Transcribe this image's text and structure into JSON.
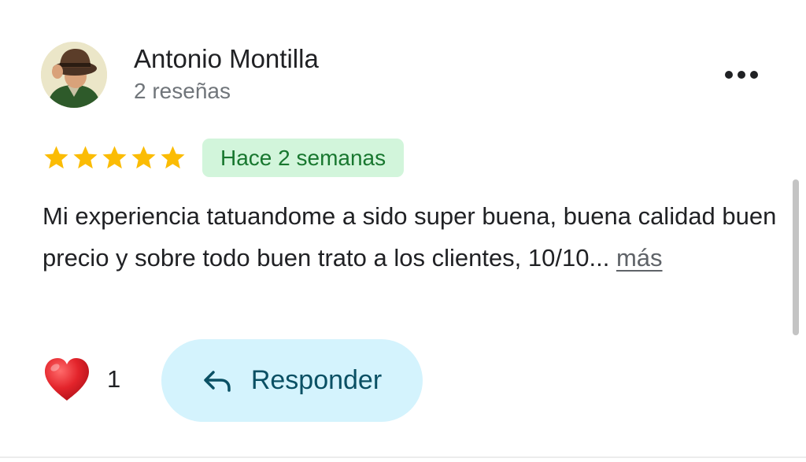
{
  "review": {
    "author": {
      "name": "Antonio Montilla",
      "review_count": "2 reseñas",
      "avatar_icon": "avatar-man-with-fedora-hat"
    },
    "rating": 5,
    "rating_max": 5,
    "time_ago": "Hace 2 semanas",
    "text": "Mi experiencia tatuandome a sido super buena, buena calidad buen precio y sobre todo buen trato a los clientes, 10/10...",
    "more_label": "más",
    "likes": {
      "icon": "heart-icon",
      "count": "1"
    },
    "reply": {
      "icon": "reply-arrow-icon",
      "label": "Responder"
    },
    "options_icon": "more-horizontal-icon"
  },
  "colors": {
    "star": "#fbbc04",
    "badge_background": "#d2f5db",
    "badge_text": "#18772f",
    "reply_background": "#d4f3fd",
    "reply_text": "#0a5064",
    "heart": "#e3242b"
  }
}
